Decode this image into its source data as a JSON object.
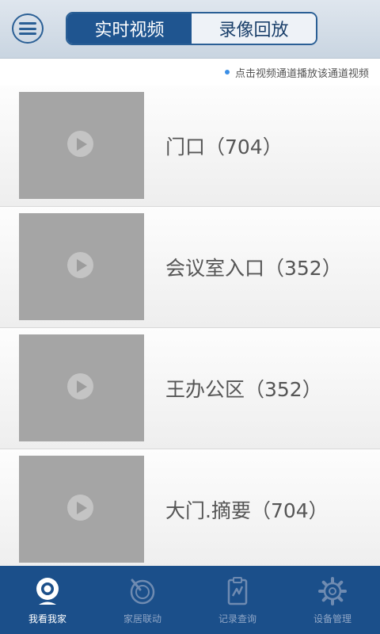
{
  "header": {
    "menu_icon": "hamburger-menu-icon",
    "tabs": [
      {
        "label": "实时视频",
        "active": true
      },
      {
        "label": "录像回放",
        "active": false
      }
    ]
  },
  "hint": {
    "text": "点击视频通道播放该通道视频"
  },
  "channels": [
    {
      "label": "门口（704）"
    },
    {
      "label": "会议室入口（352）"
    },
    {
      "label": "王办公区（352）"
    },
    {
      "label": "大门.摘要（704）"
    }
  ],
  "bottom_nav": [
    {
      "label": "我看我家",
      "icon": "webcam-icon",
      "active": true
    },
    {
      "label": "家居联动",
      "icon": "linkage-dial-icon",
      "active": false
    },
    {
      "label": "记录查询",
      "icon": "record-clipboard-icon",
      "active": false
    },
    {
      "label": "设备管理",
      "icon": "gear-icon",
      "active": false
    }
  ],
  "colors": {
    "accent": "#1f5590",
    "bottom_bar": "#1b4f8a",
    "thumbnail": "#a5a5a5"
  }
}
